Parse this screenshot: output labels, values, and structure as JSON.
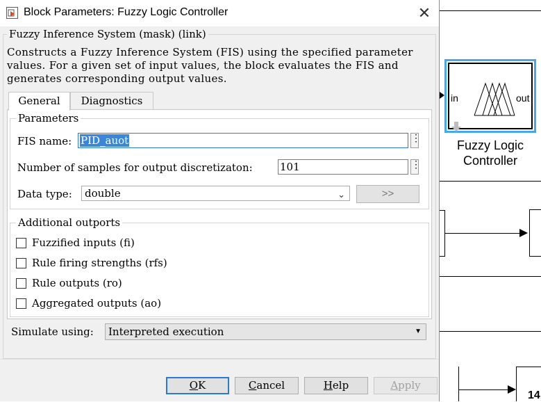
{
  "dialog": {
    "title": "Block Parameters: Fuzzy Logic Controller",
    "close_glyph": "✕",
    "group_title": "Fuzzy Inference System (mask) (link)",
    "description": "Constructs a Fuzzy Inference System (FIS) using the specified parameter values. For a given set of input values, the block evaluates the FIS and generates corresponding output values.",
    "tabs": [
      {
        "label": "General",
        "active": true
      },
      {
        "label": "Diagnostics",
        "active": false
      }
    ],
    "parameters": {
      "legend": "Parameters",
      "fis_name_label": "FIS name:",
      "fis_name_value": "PID_auot",
      "samples_label": "Number of samples for output discretizaton:",
      "samples_value": "101",
      "data_type_label": "Data type:",
      "data_type_value": "double",
      "expand_button_label": ">>"
    },
    "outports": {
      "legend": "Additional outports",
      "items": [
        {
          "label": "Fuzzified inputs (fi)",
          "checked": false
        },
        {
          "label": "Rule firing strengths (rfs)",
          "checked": false
        },
        {
          "label": "Rule outputs (ro)",
          "checked": false
        },
        {
          "label": "Aggregated outputs (ao)",
          "checked": false
        }
      ]
    },
    "simulate": {
      "label": "Simulate using:",
      "value": "Interpreted execution"
    },
    "buttons": {
      "ok": {
        "mnemonic": "O",
        "rest": "K"
      },
      "cancel": {
        "mnemonic": "C",
        "rest": "ancel"
      },
      "help": {
        "mnemonic": "H",
        "rest": "elp"
      },
      "apply": {
        "mnemonic": "A",
        "rest": "pply"
      }
    }
  },
  "canvas": {
    "block_name": "Fuzzy Logic Controller",
    "in_port": "in",
    "out_port": "out",
    "bottom_fragment_1": "14",
    "selection_color": "#46a8e6"
  }
}
